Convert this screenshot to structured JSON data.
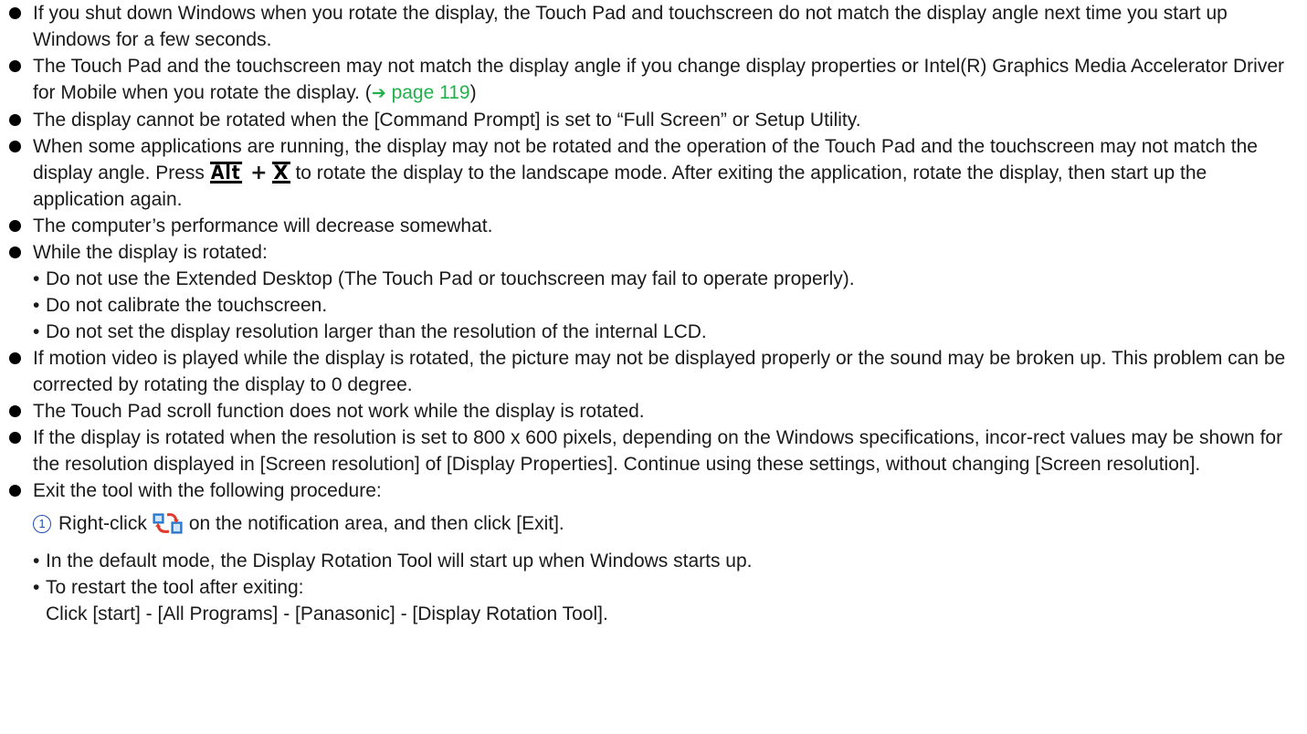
{
  "bullets": [
    "If you shut down Windows when you rotate the display, the Touch Pad and touchscreen do not match the display angle next time you start up Windows for a few seconds.",
    "The Touch Pad and the touchscreen may not match the display angle if you change display properties or Intel(R) Graphics Media Accelerator Driver for Mobile when you rotate the display. (",
    "The display cannot be rotated when the [Command Prompt] is set to “Full Screen” or Setup Utility.",
    "When some applications are running, the display may not be rotated and the operation of the Touch Pad and the touchscreen may not match the display angle. Press",
    "The computer’s performance will decrease somewhat.",
    "While the display is rotated:",
    "If motion video is played while the display is rotated, the picture may not be displayed properly or the sound may be broken up. This problem can be corrected by rotating the display to 0 degree.",
    "The Touch Pad scroll function does not work while the display is rotated.",
    "If the display is rotated when the resolution is set to 800 x 600 pixels, depending on the Windows specifications, incor-rect values may be shown for the resolution displayed in [Screen resolution] of [Display Properties]. Continue using these settings, without changing [Screen resolution].",
    "Exit the tool with the following procedure:"
  ],
  "b2_link": "page 119",
  "b2_close": ")",
  "b4_keys": {
    "alt": "Alt",
    "plus": "+",
    "x": "X"
  },
  "b4_tail": "to rotate the display to the landscape mode. After exiting the application, rotate the display, then start up the application again.",
  "rotated_subitems": [
    "Do not use the Extended Desktop (The Touch Pad or touchscreen may fail to operate properly).",
    "Do not calibrate the touchscreen.",
    "Do not set the display resolution larger than the resolution of the internal LCD."
  ],
  "step1": {
    "num": "1",
    "pre": "Right-click",
    "post": "on the notification area, and then click [Exit]."
  },
  "exit_subitems": [
    "In the default mode, the Display Rotation Tool will start up when Windows starts up.",
    "To restart the tool after exiting:"
  ],
  "restart_path": "Click [start] - [All Programs] - [Panasonic] - [Display Rotation Tool].",
  "colors": {
    "link": "#22b04b",
    "step_number": "#1e4fb5",
    "icon_blue": "#3a8ee6",
    "icon_red": "#e23a2a"
  },
  "icons": {
    "bullet": "filled-circle",
    "arrow": "right-arrow",
    "tool": "display-rotation-tool-icon"
  }
}
